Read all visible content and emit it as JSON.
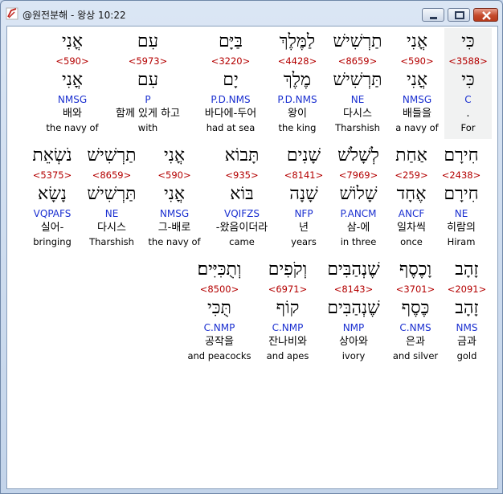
{
  "window": {
    "title": "@원전분해 - 왕상 10:22"
  },
  "icons": {
    "app": "app-icon",
    "minimize": "minimize-icon",
    "maximize": "maximize-icon",
    "close": "close-icon"
  },
  "colors": {
    "strong_number": "#b40000",
    "morphology": "#1a2fd0",
    "selected_background": "#f1f2f2",
    "close_button": "#c44a2c"
  },
  "rows": [
    {
      "words": [
        {
          "hebrew": "כִּי",
          "strong": "<3588>",
          "lemma": "כִּי",
          "morph": "C",
          "korean": ".",
          "english": "For",
          "selected": true
        },
        {
          "hebrew": "אֳנִי",
          "strong": "<590>",
          "lemma": "אֳנִי",
          "morph": "NMSG",
          "korean": "배들을",
          "english": "a navy of"
        },
        {
          "hebrew": "תַרְשִׁישׁ",
          "strong": "<8659>",
          "lemma": "תַּרְשִׁישׁ",
          "morph": "NE",
          "korean": "다시스",
          "english": "Tharshish"
        },
        {
          "hebrew": "לַמֶּלֶךְ",
          "strong": "<4428>",
          "lemma": "מֶלֶךְ",
          "morph": "P.D.NMS",
          "korean": "왕이",
          "english": "the king"
        },
        {
          "hebrew": "בַּיָּם",
          "strong": "<3220>",
          "lemma": "יָם",
          "morph": "P.D.NMS",
          "korean": "바다에-두어",
          "english": "had at sea"
        },
        {
          "hebrew": "עִם",
          "strong": "<5973>",
          "lemma": "עִם",
          "morph": "P",
          "korean": "함께 있게 하고",
          "english": "with"
        },
        {
          "hebrew": "אֳנִי",
          "strong": "<590>",
          "lemma": "אֳנִי",
          "morph": "NMSG",
          "korean": "배와",
          "english": "the navy of"
        }
      ]
    },
    {
      "words": [
        {
          "hebrew": "חִירָם",
          "strong": "<2438>",
          "lemma": "חִירָם",
          "morph": "NE",
          "korean": "히람의",
          "english": "Hiram"
        },
        {
          "hebrew": "אַחַת",
          "strong": "<259>",
          "lemma": "אֶחָד",
          "morph": "ANCF",
          "korean": "일차씩",
          "english": "once"
        },
        {
          "hebrew": "לְשָׁלֹשׁ",
          "strong": "<7969>",
          "lemma": "שָׁלוֹשׁ",
          "morph": "P.ANCM",
          "korean": "삼-에",
          "english": "in three"
        },
        {
          "hebrew": "שָׁנִים",
          "strong": "<8141>",
          "lemma": "שָׁנָה",
          "morph": "NFP",
          "korean": "년",
          "english": "years"
        },
        {
          "hebrew": "תָּבוֹא",
          "strong": "<935>",
          "lemma": "בּוֹא",
          "morph": "VQIFZS",
          "korean": "-왔음이더라",
          "english": "came"
        },
        {
          "hebrew": "אֳנִי",
          "strong": "<590>",
          "lemma": "אֳנִי",
          "morph": "NMSG",
          "korean": "그-배로",
          "english": "the navy of"
        },
        {
          "hebrew": "תַרְשִׁישׁ",
          "strong": "<8659>",
          "lemma": "תַּרְשִׁישׁ",
          "morph": "NE",
          "korean": "다시스",
          "english": "Tharshish"
        },
        {
          "hebrew": "נֹשְׂאֵת",
          "strong": "<5375>",
          "lemma": "נָשָׂא",
          "morph": "VQPAFS",
          "korean": "실어-",
          "english": "bringing"
        }
      ]
    },
    {
      "words": [
        {
          "hebrew": "זָהָב",
          "strong": "<2091>",
          "lemma": "זָהָב",
          "morph": "NMS",
          "korean": "금과",
          "english": "gold"
        },
        {
          "hebrew": "וָכֶסֶף",
          "strong": "<3701>",
          "lemma": "כֶּסֶף",
          "morph": "C.NMS",
          "korean": "은과",
          "english": "and silver"
        },
        {
          "hebrew": "שֶׁנְהַבִּים",
          "strong": "<8143>",
          "lemma": "שֶׁנְהַבִּים",
          "morph": "NMP",
          "korean": "상아와",
          "english": "ivory"
        },
        {
          "hebrew": "וְקֹפִים",
          "strong": "<6971>",
          "lemma": "קוֹף",
          "morph": "C.NMP",
          "korean": "잔나비와",
          "english": "and apes"
        },
        {
          "hebrew": "וְתֻכִּיִּים׃",
          "strong": "<8500>",
          "lemma": "תֻּכִּי",
          "morph": "C.NMP",
          "korean": "공작을",
          "english": "and peacocks"
        }
      ]
    }
  ]
}
